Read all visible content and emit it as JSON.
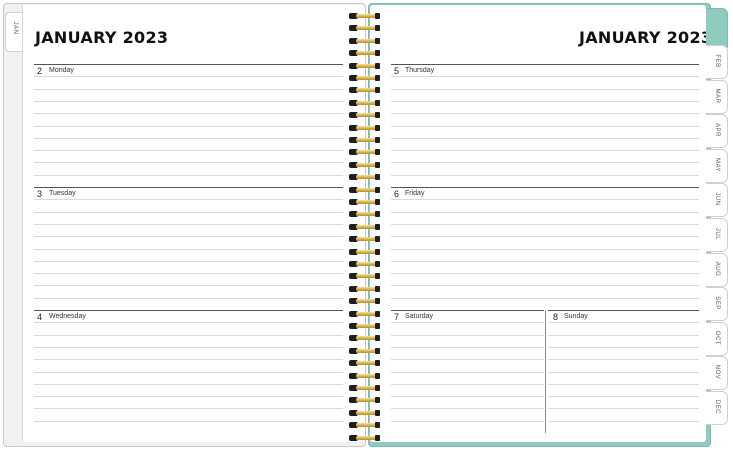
{
  "left": {
    "title": "JANUARY 2023",
    "tab": "JAN",
    "days": [
      {
        "num": "2",
        "name": "Monday"
      },
      {
        "num": "3",
        "name": "Tuesday"
      },
      {
        "num": "4",
        "name": "Wednesday"
      }
    ]
  },
  "right": {
    "title": "JANUARY 2023",
    "days": [
      {
        "num": "5",
        "name": "Thursday"
      },
      {
        "num": "6",
        "name": "Friday"
      },
      {
        "num": "7",
        "name": "Saturday"
      },
      {
        "num": "8",
        "name": "Sunday"
      }
    ],
    "tabs": [
      "FEB",
      "MAR",
      "APR",
      "MAY",
      "JUN",
      "JUL",
      "AUG",
      "SEP",
      "OCT",
      "NOV",
      "DEC"
    ]
  },
  "colors": {
    "accent": "#8fcbbf",
    "spiral_gold": "#d7b04b",
    "spiral_black": "#1e1e1e"
  }
}
